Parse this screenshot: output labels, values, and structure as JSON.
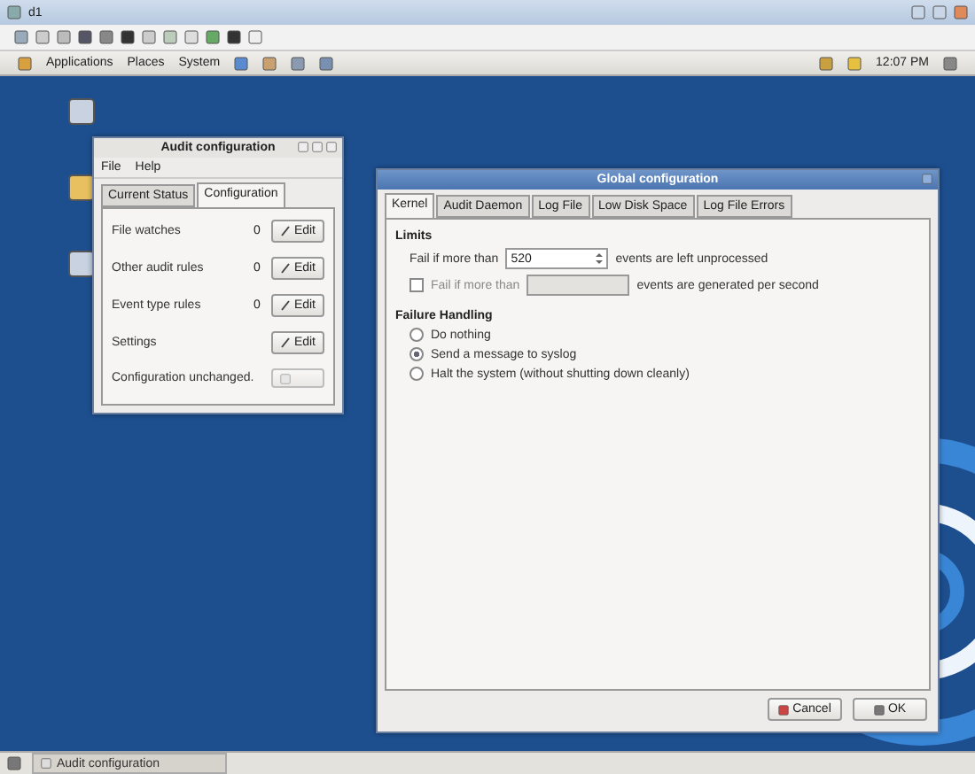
{
  "vm_window": {
    "title": "d1"
  },
  "panel": {
    "menus": [
      "Applications",
      "Places",
      "System"
    ],
    "clock": "12:07 PM"
  },
  "audit_window": {
    "title": "Audit configuration",
    "menu": [
      "File",
      "Help"
    ],
    "tabs": [
      {
        "label": "Current Status",
        "selected": false
      },
      {
        "label": "Configuration",
        "selected": true
      }
    ],
    "rows": [
      {
        "label": "File watches",
        "count": "0",
        "button": "Edit"
      },
      {
        "label": "Other audit rules",
        "count": "0",
        "button": "Edit"
      },
      {
        "label": "Event type rules",
        "count": "0",
        "button": "Edit"
      },
      {
        "label": "Settings",
        "button": "Edit"
      }
    ],
    "status": "Configuration unchanged.",
    "save_disabled": true
  },
  "global_window": {
    "title": "Global configuration",
    "tabs": [
      {
        "label": "Kernel",
        "selected": true
      },
      {
        "label": "Audit Daemon",
        "selected": false
      },
      {
        "label": "Log File",
        "selected": false
      },
      {
        "label": "Low Disk Space",
        "selected": false
      },
      {
        "label": "Log File Errors",
        "selected": false
      }
    ],
    "limits_title": "Limits",
    "limits": [
      {
        "kind": "label",
        "label": "Fail if more than",
        "value": "520",
        "disabled": false,
        "suffix": "events are left unprocessed"
      },
      {
        "kind": "checkbox",
        "checked": false,
        "label": "Fail if more than",
        "disabled": true,
        "suffix": "events are generated per second"
      }
    ],
    "failure_title": "Failure Handling",
    "options": [
      {
        "label": "Do nothing",
        "selected": false
      },
      {
        "label": "Send a message to syslog",
        "selected": true
      },
      {
        "label": "Halt the system (without shutting down cleanly)",
        "selected": false
      }
    ],
    "buttons": [
      "Cancel",
      "OK"
    ]
  },
  "taskbar": {
    "items": [
      "Audit configuration"
    ]
  }
}
